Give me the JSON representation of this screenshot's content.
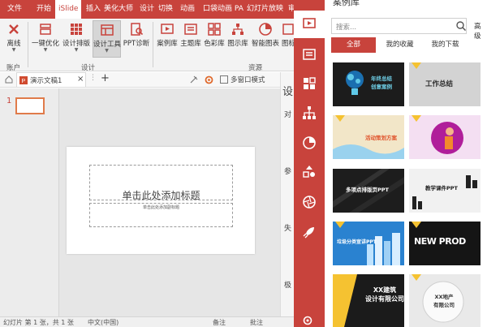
{
  "ribbon": {
    "tabs": [
      "文件",
      "开始",
      "iSlide",
      "插入",
      "美化大师",
      "设计",
      "切换",
      "动画",
      "口袋动画 PA",
      "幻灯片放映",
      "审"
    ],
    "active_tab": "iSlide",
    "buttons": {
      "dehuang": "离线",
      "one_click": "一键优化",
      "design_layout": "设计排版",
      "design_tools": "设计工具",
      "ppt_diagnose": "PPT诊断",
      "case_lib": "案例库",
      "theme_lib": "主题库",
      "color_lib": "色彩库",
      "chart_lib": "图示库",
      "smart_chart": "智能图表",
      "icon_lib": "图标"
    },
    "groups": {
      "account": "账户",
      "design": "设计",
      "resources": "资源"
    }
  },
  "doc_tabs": {
    "doc_name": "演示文稿1",
    "close": "×",
    "add": "+",
    "multi_window": "多窗口模式"
  },
  "slides": {
    "number": "1"
  },
  "slide": {
    "title": "单击此处添加标题",
    "subtitle": "单击此处添加副标题"
  },
  "status": {
    "slide_count": "幻灯片 第 1 张，共 1 张",
    "language": "中文(中国)",
    "notes": "备注",
    "comments": "批注"
  },
  "right_pane": {
    "title": "设",
    "row1": "对",
    "row2": "参",
    "row3": "失",
    "row4": "极"
  },
  "library": {
    "title": "案例库",
    "search_placeholder": "搜索...",
    "advanced": "高级",
    "filters": [
      "全部",
      "我的收藏",
      "我的下载"
    ],
    "cards": [
      {
        "text": "年终总结\n创意案例",
        "bg": "#1c1c1c",
        "fg": "#6fd0e8"
      },
      {
        "text": "工作总结",
        "bg": "#cfcfcf",
        "fg": "#2b2b2b"
      },
      {
        "text": "活动策划方案",
        "bg": "#f2e6c8",
        "fg": "#e0532b"
      },
      {
        "text": "",
        "bg": "#f4dff2",
        "fg": "#b01e9a"
      },
      {
        "text": "多项点排版页PPT",
        "bg": "#1d1d1d",
        "fg": "#ffffff"
      },
      {
        "text": "教学课件PPT",
        "bg": "#f1f1f1",
        "fg": "#222222"
      },
      {
        "text": "垃圾分类宣讲PPT",
        "bg": "#2a82d0",
        "fg": "#ffffff"
      },
      {
        "text": "NEW PROD",
        "bg": "#151515",
        "fg": "#ffffff"
      },
      {
        "text": "XX建筑\n设计有限公司",
        "bg": "#1b1b1b",
        "fg": "#ffffff"
      },
      {
        "text": "XX地产\n有限公司",
        "bg": "#e9e9e9",
        "fg": "#333333"
      }
    ]
  },
  "colors": {
    "brand": "#c8433c",
    "badge": "#f5c231"
  }
}
